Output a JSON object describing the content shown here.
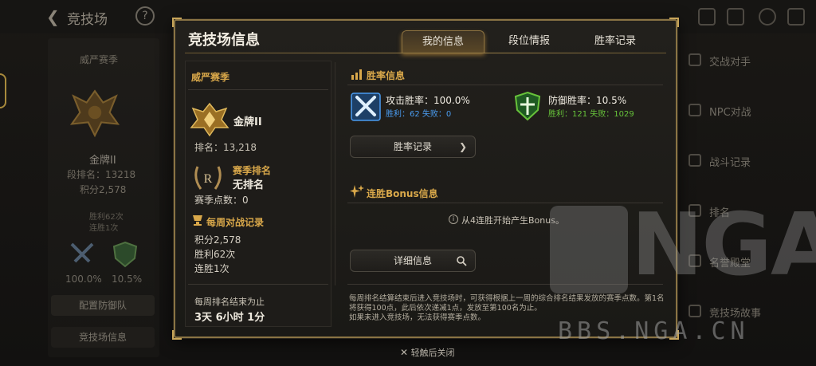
{
  "background": {
    "title": "竞技场",
    "help_icon": "?",
    "left": {
      "season": "威严赛季",
      "tier": "金牌II",
      "rank": "段排名：13218",
      "score": "积分2,578",
      "wins": "胜利62次",
      "streak": "连胜1次",
      "attack_rate": "100.0%",
      "defense_rate": "10.5%",
      "defense_button": "配置防御队",
      "arena_button": "竞技场信息"
    },
    "right_menu": [
      "交战对手",
      "NPC对战",
      "战斗记录",
      "排名",
      "名誉殿堂",
      "竞技场故事"
    ]
  },
  "watermark": {
    "logo": "NGA",
    "url": "BBS.NGA.CN"
  },
  "modal": {
    "title": "竞技场信息",
    "tabs": [
      {
        "label": "我的信息",
        "active": true
      },
      {
        "label": "段位情报",
        "active": false
      },
      {
        "label": "胜率记录",
        "active": false
      }
    ],
    "left": {
      "season_label": "威严赛季",
      "tier": "金牌II",
      "rank": "排名：13,218",
      "season_rank_label": "赛季排名",
      "season_rank_value": "无排名",
      "season_points": "赛季点数：0",
      "weekly_title": "每周对战记录",
      "weekly_score": "积分2,578",
      "weekly_wins": "胜利62次",
      "weekly_streak": "连胜1次",
      "weekly_end_label": "每周排名结束为止",
      "weekly_end_value": "3天 6小时 1分"
    },
    "right": {
      "win_rate_title": "胜率信息",
      "attack": {
        "label": "攻击胜率：100.0%",
        "detail": "胜利：62 失败：0",
        "color": "#4a9cf0"
      },
      "defense": {
        "label": "防御胜率：10.5%",
        "detail": "胜利：121 失败：1029",
        "color": "#67c23a"
      },
      "record_button": "胜率记录",
      "bonus_title": "连胜Bonus信息",
      "bonus_note": "从4连胜开始产生Bonus。",
      "detail_button": "详细信息",
      "footer": [
        "每周排名结算结束后进入竞技场时，可获得根据上一周的综合排名结果发放的赛季点数。第1名将获得100点，此后依次递减1点，发放至第100名为止。",
        "如果未进入竞技场，无法获得赛季点数。"
      ]
    }
  },
  "close_hint": "轻触后关闭",
  "colors": {
    "gold": "#d9a84a",
    "frame": "#8a7444",
    "attack_blue": "#4a9cf0",
    "defense_green": "#67c23a"
  }
}
